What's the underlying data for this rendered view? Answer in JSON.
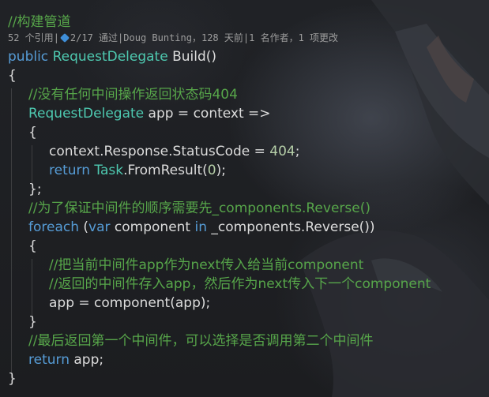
{
  "code": {
    "comment_build_pipeline": "//构建管道",
    "codelens": {
      "references": "52 个引用",
      "tests": "2/17 通过",
      "author_info": "Doug Bunting，128 天前",
      "changes": "1 名作者，1 项更改"
    },
    "l_public": "public",
    "l_type_request_delegate": "RequestDelegate",
    "l_build": " Build()",
    "open_brace_1": "{",
    "comment_404": "//没有任何中间操作返回状态码404",
    "app_decl_type": "RequestDelegate",
    "app_decl_rest": " app = context =>",
    "open_brace_2": "{",
    "status_code_start": "context.Response.StatusCode = ",
    "status_code_value": "404",
    "status_code_end": ";",
    "return_kw": "return",
    "task_type": "Task",
    "from_result": ".FromResult(",
    "zero": "0",
    "from_result_end": ");",
    "close_brace_semicolon": "};",
    "comment_reverse": "//为了保证中间件的顺序需要先_components.Reverse()",
    "foreach_kw": "foreach",
    "paren_open": " (",
    "var_kw": "var",
    "component_word": " component ",
    "in_kw": "in",
    "foreach_rest": " _components.Reverse())",
    "open_brace_3": "{",
    "comment_current": "//把当前中间件app作为next传入给当前component",
    "comment_next": "//返回的中间件存入app，然后作为next传入下一个component",
    "assign": "app = component(app);",
    "close_brace_3": "}",
    "comment_last": "//最后返回第一个中间件，可以选择是否调用第二个中间件",
    "return_kw_2": "return",
    "return_app": " app;",
    "close_brace_1": "}"
  },
  "colors": {
    "comment": "#57a64a",
    "keyword": "#569cd6",
    "type": "#4ec9b0",
    "number": "#b5cea8",
    "text": "#dcdcdc",
    "codelens": "#9d9d9d"
  },
  "icons": [
    "test-passed-icon"
  ]
}
